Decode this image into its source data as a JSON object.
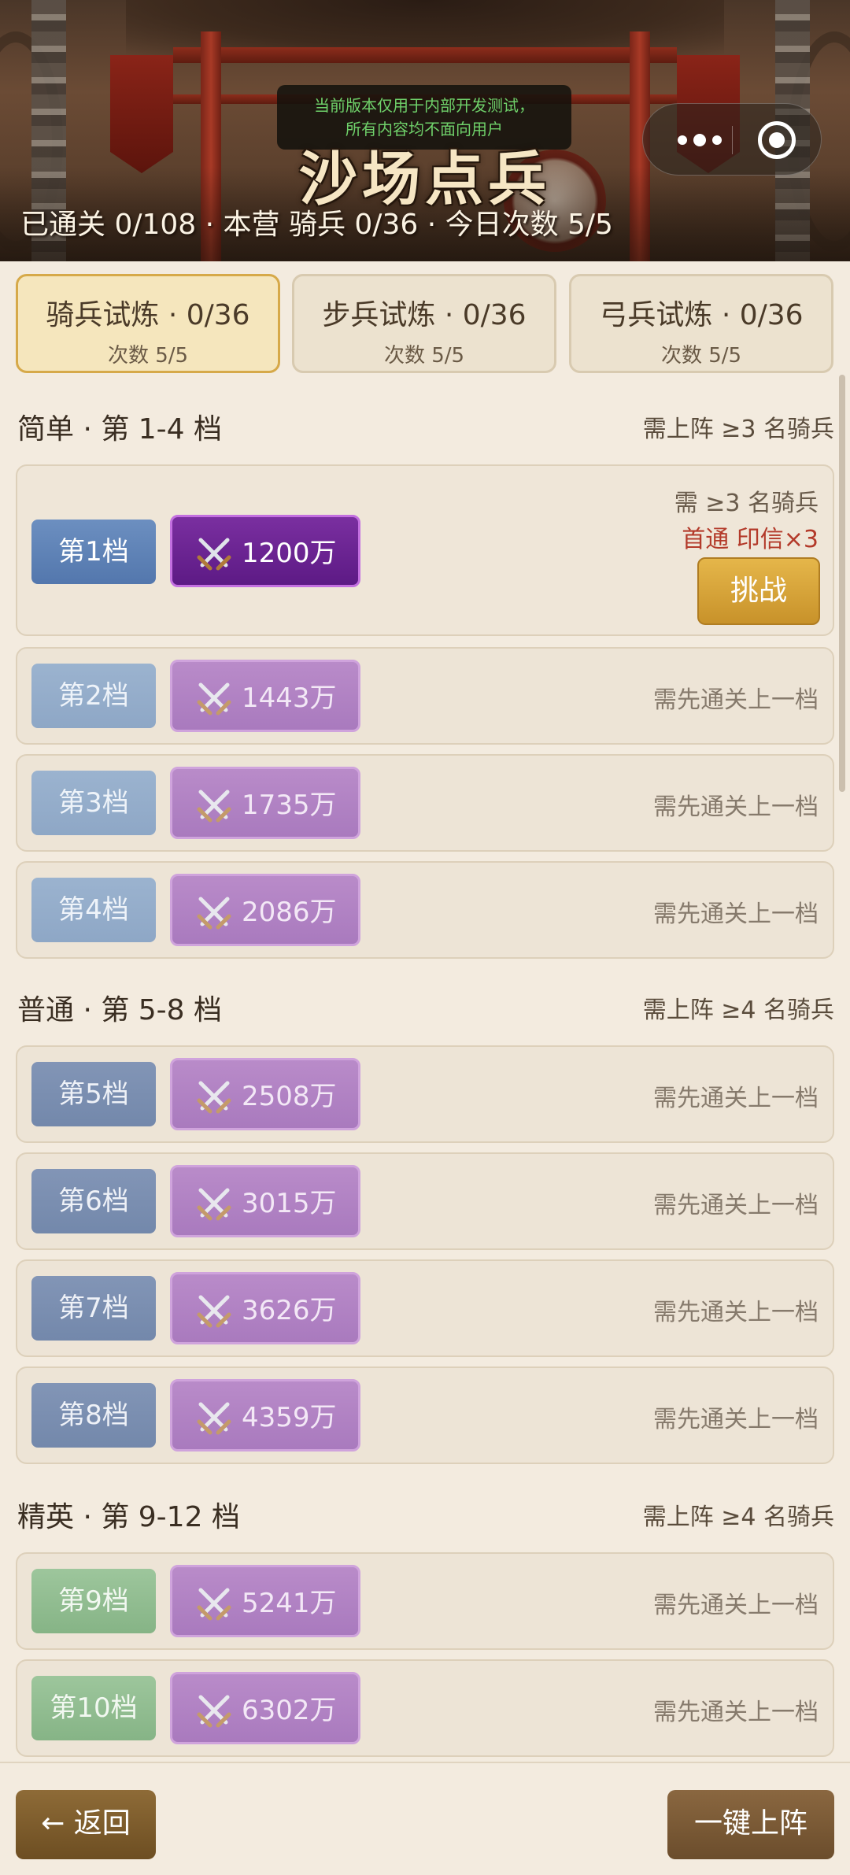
{
  "header": {
    "dev_notice_line1": "当前版本仅用于内部开发测试，",
    "dev_notice_line2": "所有内容均不面向用户",
    "title": "沙场点兵",
    "stats": "已通关 0/108 · 本营 骑兵 0/36 · 今日次数 5/5"
  },
  "capsule": {
    "more_icon": "more-dots-icon",
    "close_icon": "target-circle-icon"
  },
  "tabs": [
    {
      "label": "骑兵试炼 · 0/36",
      "sub": "次数 5/5",
      "active": true
    },
    {
      "label": "步兵试炼 · 0/36",
      "sub": "次数 5/5",
      "active": false
    },
    {
      "label": "弓兵试炼 · 0/36",
      "sub": "次数 5/5",
      "active": false
    }
  ],
  "sections": [
    {
      "title": "简单 · 第 1-4 档",
      "requirement": "需上阵 ≥3 名骑兵"
    },
    {
      "title": "普通 · 第 5-8 档",
      "requirement": "需上阵 ≥4 名骑兵"
    },
    {
      "title": "精英 · 第 9-12 档",
      "requirement": "需上阵 ≥4 名骑兵"
    }
  ],
  "tiers": [
    {
      "label": "第1档",
      "power": "1200万",
      "requirement": "需 ≥3 名骑兵",
      "reward": "首通 印信×3",
      "button": "挑战"
    },
    {
      "label": "第2档",
      "power": "1443万",
      "hint": "需先通关上一档"
    },
    {
      "label": "第3档",
      "power": "1735万",
      "hint": "需先通关上一档"
    },
    {
      "label": "第4档",
      "power": "2086万",
      "hint": "需先通关上一档"
    },
    {
      "label": "第5档",
      "power": "2508万",
      "hint": "需先通关上一档"
    },
    {
      "label": "第6档",
      "power": "3015万",
      "hint": "需先通关上一档"
    },
    {
      "label": "第7档",
      "power": "3626万",
      "hint": "需先通关上一档"
    },
    {
      "label": "第8档",
      "power": "4359万",
      "hint": "需先通关上一档"
    },
    {
      "label": "第9档",
      "power": "5241万",
      "hint": "需先通关上一档"
    },
    {
      "label": "第10档",
      "power": "6302万",
      "hint": "需先通关上一档"
    }
  ],
  "footer": {
    "back_label": "← 返回",
    "deploy_label": "一键上阵"
  },
  "colors": {
    "accent_gold": "#d6a949",
    "power_purple": "#5d1a85",
    "reward_red": "#b33a2a"
  },
  "icons": {
    "power": "crossed-swords-icon"
  }
}
